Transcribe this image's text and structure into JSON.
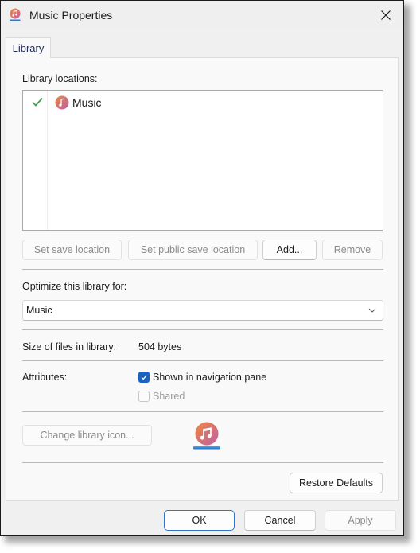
{
  "window": {
    "title": "Music Properties",
    "title_icon": "music-library-icon",
    "close_icon": "close-icon"
  },
  "tabs": [
    {
      "label": "Library",
      "active": true
    }
  ],
  "library_locations": {
    "label": "Library locations:",
    "items": [
      {
        "name": "Music",
        "is_default_save": true,
        "icon": "music-folder-icon"
      }
    ],
    "buttons": {
      "set_save_location": "Set save location",
      "set_public_save_location": "Set public save location",
      "add": "Add...",
      "remove": "Remove"
    }
  },
  "optimize": {
    "label": "Optimize this library for:",
    "selected": "Music"
  },
  "size": {
    "label": "Size of files in library:",
    "value": "504 bytes"
  },
  "attributes": {
    "label": "Attributes:",
    "options": [
      {
        "label": "Shown in navigation pane",
        "checked": true,
        "enabled": true
      },
      {
        "label": "Shared",
        "checked": false,
        "enabled": false
      }
    ]
  },
  "icon_section": {
    "change_icon_label": "Change library icon...",
    "current_icon": "music-library-icon"
  },
  "restore_defaults_label": "Restore Defaults",
  "footer": {
    "ok": "OK",
    "cancel": "Cancel",
    "apply": "Apply"
  },
  "colors": {
    "accent": "#1d62c0",
    "check_green": "#3aa04a",
    "music_gradient_start": "#f0873f",
    "music_gradient_end": "#c45fa0"
  }
}
